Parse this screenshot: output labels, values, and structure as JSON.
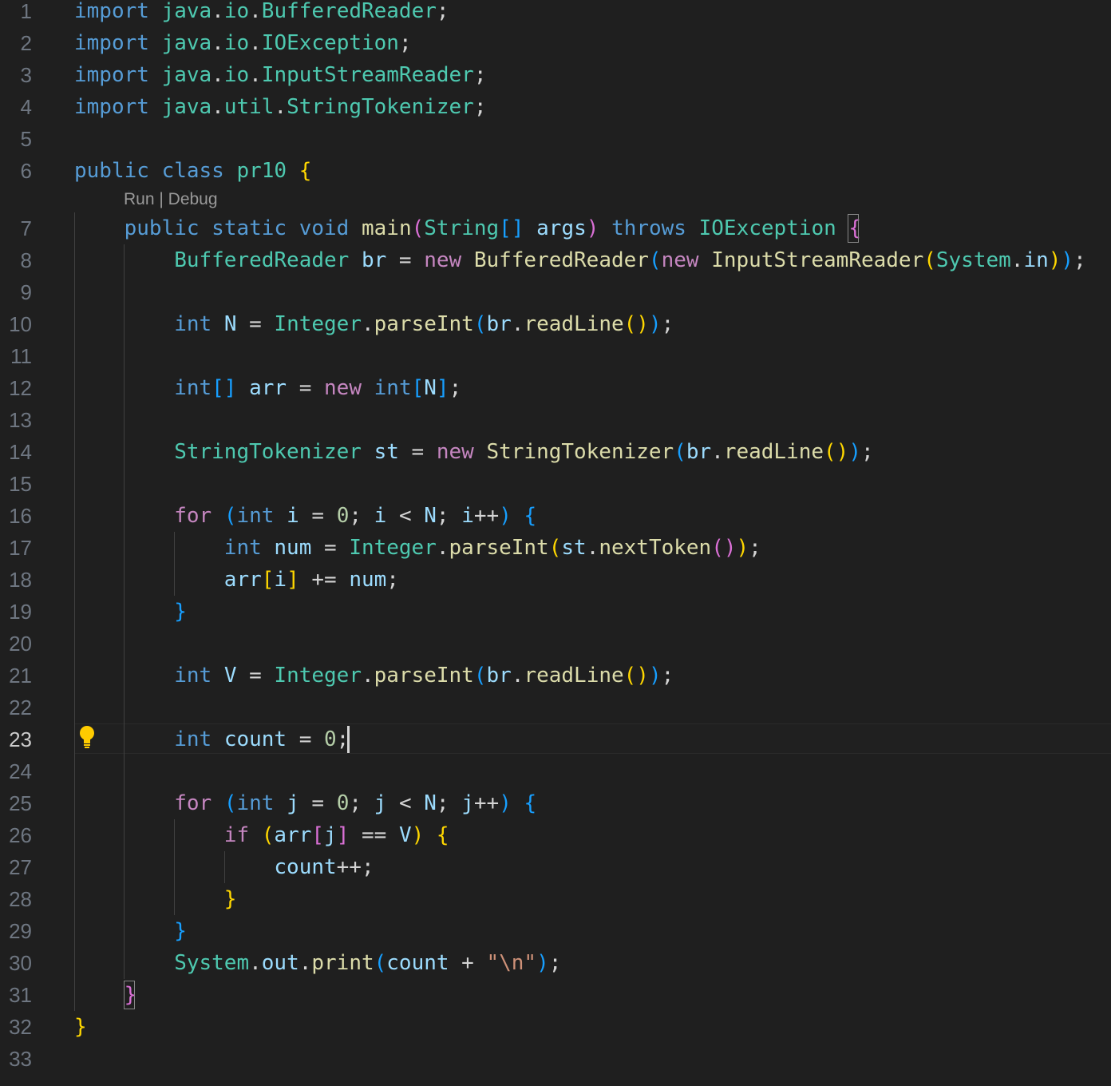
{
  "editor": {
    "active_line": 23,
    "codelens": {
      "run": "Run",
      "separator": " | ",
      "debug": "Debug"
    },
    "lines": [
      {
        "n": "1",
        "t": [
          [
            "import",
            "kw"
          ],
          [
            " ",
            ""
          ],
          [
            "java",
            "ty"
          ],
          [
            ".",
            ""
          ],
          [
            "io",
            "ty"
          ],
          [
            ".",
            ""
          ],
          [
            "BufferedReader",
            "ty"
          ],
          [
            ";",
            ""
          ]
        ]
      },
      {
        "n": "2",
        "t": [
          [
            "import",
            "kw"
          ],
          [
            " ",
            ""
          ],
          [
            "java",
            "ty"
          ],
          [
            ".",
            ""
          ],
          [
            "io",
            "ty"
          ],
          [
            ".",
            ""
          ],
          [
            "IOException",
            "ty"
          ],
          [
            ";",
            ""
          ]
        ]
      },
      {
        "n": "3",
        "t": [
          [
            "import",
            "kw"
          ],
          [
            " ",
            ""
          ],
          [
            "java",
            "ty"
          ],
          [
            ".",
            ""
          ],
          [
            "io",
            "ty"
          ],
          [
            ".",
            ""
          ],
          [
            "InputStreamReader",
            "ty"
          ],
          [
            ";",
            ""
          ]
        ]
      },
      {
        "n": "4",
        "t": [
          [
            "import",
            "kw"
          ],
          [
            " ",
            ""
          ],
          [
            "java",
            "ty"
          ],
          [
            ".",
            ""
          ],
          [
            "util",
            "ty"
          ],
          [
            ".",
            ""
          ],
          [
            "StringTokenizer",
            "ty"
          ],
          [
            ";",
            ""
          ]
        ]
      },
      {
        "n": "5",
        "t": []
      },
      {
        "n": "6",
        "t": [
          [
            "public",
            "kw"
          ],
          [
            " ",
            ""
          ],
          [
            "class",
            "kw"
          ],
          [
            " ",
            ""
          ],
          [
            "pr10",
            "ty"
          ],
          [
            " ",
            ""
          ],
          [
            "{",
            "b1"
          ]
        ]
      },
      {
        "n": "7",
        "t": [
          [
            "    ",
            ""
          ],
          [
            "public",
            "kw"
          ],
          [
            " ",
            ""
          ],
          [
            "static",
            "kw"
          ],
          [
            " ",
            ""
          ],
          [
            "void",
            "kw"
          ],
          [
            " ",
            ""
          ],
          [
            "main",
            "fn"
          ],
          [
            "(",
            "b2"
          ],
          [
            "String",
            "ty"
          ],
          [
            "[]",
            "b3"
          ],
          [
            " ",
            ""
          ],
          [
            "args",
            "var"
          ],
          [
            ")",
            "b2"
          ],
          [
            " ",
            ""
          ],
          [
            "throws",
            "kw"
          ],
          [
            " ",
            ""
          ],
          [
            "IOException",
            "ty"
          ],
          [
            " ",
            ""
          ],
          [
            "{",
            "b2"
          ]
        ]
      },
      {
        "n": "8",
        "t": [
          [
            "        ",
            ""
          ],
          [
            "BufferedReader",
            "ty"
          ],
          [
            " ",
            ""
          ],
          [
            "br",
            "var"
          ],
          [
            " = ",
            ""
          ],
          [
            "new",
            "ctl"
          ],
          [
            " ",
            ""
          ],
          [
            "BufferedReader",
            "fn"
          ],
          [
            "(",
            "b3"
          ],
          [
            "new",
            "ctl"
          ],
          [
            " ",
            ""
          ],
          [
            "InputStreamReader",
            "fn"
          ],
          [
            "(",
            "b1"
          ],
          [
            "System",
            "ty"
          ],
          [
            ".",
            ""
          ],
          [
            "in",
            "var"
          ],
          [
            ")",
            "b1"
          ],
          [
            ")",
            "b3"
          ],
          [
            ";",
            ""
          ]
        ]
      },
      {
        "n": "9",
        "t": []
      },
      {
        "n": "10",
        "t": [
          [
            "        ",
            ""
          ],
          [
            "int",
            "kw"
          ],
          [
            " ",
            ""
          ],
          [
            "N",
            "var"
          ],
          [
            " = ",
            ""
          ],
          [
            "Integer",
            "ty"
          ],
          [
            ".",
            ""
          ],
          [
            "parseInt",
            "fn"
          ],
          [
            "(",
            "b3"
          ],
          [
            "br",
            "var"
          ],
          [
            ".",
            ""
          ],
          [
            "readLine",
            "fn"
          ],
          [
            "()",
            "b1"
          ],
          [
            ")",
            "b3"
          ],
          [
            ";",
            ""
          ]
        ]
      },
      {
        "n": "11",
        "t": []
      },
      {
        "n": "12",
        "t": [
          [
            "        ",
            ""
          ],
          [
            "int",
            "kw"
          ],
          [
            "[]",
            "b3"
          ],
          [
            " ",
            ""
          ],
          [
            "arr",
            "var"
          ],
          [
            " = ",
            ""
          ],
          [
            "new",
            "ctl"
          ],
          [
            " ",
            ""
          ],
          [
            "int",
            "kw"
          ],
          [
            "[",
            "b3"
          ],
          [
            "N",
            "var"
          ],
          [
            "]",
            "b3"
          ],
          [
            ";",
            ""
          ]
        ]
      },
      {
        "n": "13",
        "t": []
      },
      {
        "n": "14",
        "t": [
          [
            "        ",
            ""
          ],
          [
            "StringTokenizer",
            "ty"
          ],
          [
            " ",
            ""
          ],
          [
            "st",
            "var"
          ],
          [
            " = ",
            ""
          ],
          [
            "new",
            "ctl"
          ],
          [
            " ",
            ""
          ],
          [
            "StringTokenizer",
            "fn"
          ],
          [
            "(",
            "b3"
          ],
          [
            "br",
            "var"
          ],
          [
            ".",
            ""
          ],
          [
            "readLine",
            "fn"
          ],
          [
            "()",
            "b1"
          ],
          [
            ")",
            "b3"
          ],
          [
            ";",
            ""
          ]
        ]
      },
      {
        "n": "15",
        "t": []
      },
      {
        "n": "16",
        "t": [
          [
            "        ",
            ""
          ],
          [
            "for",
            "ctl"
          ],
          [
            " ",
            ""
          ],
          [
            "(",
            "b3"
          ],
          [
            "int",
            "kw"
          ],
          [
            " ",
            ""
          ],
          [
            "i",
            "var"
          ],
          [
            " = ",
            ""
          ],
          [
            "0",
            "num"
          ],
          [
            "; ",
            ""
          ],
          [
            "i",
            "var"
          ],
          [
            " < ",
            ""
          ],
          [
            "N",
            "var"
          ],
          [
            "; ",
            ""
          ],
          [
            "i",
            "var"
          ],
          [
            "++",
            ""
          ],
          [
            ")",
            "b3"
          ],
          [
            " ",
            ""
          ],
          [
            "{",
            "b3"
          ]
        ]
      },
      {
        "n": "17",
        "t": [
          [
            "            ",
            ""
          ],
          [
            "int",
            "kw"
          ],
          [
            " ",
            ""
          ],
          [
            "num",
            "var"
          ],
          [
            " = ",
            ""
          ],
          [
            "Integer",
            "ty"
          ],
          [
            ".",
            ""
          ],
          [
            "parseInt",
            "fn"
          ],
          [
            "(",
            "b1"
          ],
          [
            "st",
            "var"
          ],
          [
            ".",
            ""
          ],
          [
            "nextToken",
            "fn"
          ],
          [
            "()",
            "b2"
          ],
          [
            ")",
            "b1"
          ],
          [
            ";",
            ""
          ]
        ]
      },
      {
        "n": "18",
        "t": [
          [
            "            ",
            ""
          ],
          [
            "arr",
            "var"
          ],
          [
            "[",
            "b1"
          ],
          [
            "i",
            "var"
          ],
          [
            "]",
            "b1"
          ],
          [
            " += ",
            ""
          ],
          [
            "num",
            "var"
          ],
          [
            ";",
            ""
          ]
        ]
      },
      {
        "n": "19",
        "t": [
          [
            "        ",
            ""
          ],
          [
            "}",
            "b3"
          ]
        ]
      },
      {
        "n": "20",
        "t": []
      },
      {
        "n": "21",
        "t": [
          [
            "        ",
            ""
          ],
          [
            "int",
            "kw"
          ],
          [
            " ",
            ""
          ],
          [
            "V",
            "var"
          ],
          [
            " = ",
            ""
          ],
          [
            "Integer",
            "ty"
          ],
          [
            ".",
            ""
          ],
          [
            "parseInt",
            "fn"
          ],
          [
            "(",
            "b3"
          ],
          [
            "br",
            "var"
          ],
          [
            ".",
            ""
          ],
          [
            "readLine",
            "fn"
          ],
          [
            "()",
            "b1"
          ],
          [
            ")",
            "b3"
          ],
          [
            ";",
            ""
          ]
        ]
      },
      {
        "n": "22",
        "t": []
      },
      {
        "n": "23",
        "t": [
          [
            "        ",
            ""
          ],
          [
            "int",
            "kw"
          ],
          [
            " ",
            ""
          ],
          [
            "count",
            "var"
          ],
          [
            " = ",
            ""
          ],
          [
            "0",
            "num"
          ],
          [
            ";",
            ""
          ]
        ]
      },
      {
        "n": "24",
        "t": []
      },
      {
        "n": "25",
        "t": [
          [
            "        ",
            ""
          ],
          [
            "for",
            "ctl"
          ],
          [
            " ",
            ""
          ],
          [
            "(",
            "b3"
          ],
          [
            "int",
            "kw"
          ],
          [
            " ",
            ""
          ],
          [
            "j",
            "var"
          ],
          [
            " = ",
            ""
          ],
          [
            "0",
            "num"
          ],
          [
            "; ",
            ""
          ],
          [
            "j",
            "var"
          ],
          [
            " < ",
            ""
          ],
          [
            "N",
            "var"
          ],
          [
            "; ",
            ""
          ],
          [
            "j",
            "var"
          ],
          [
            "++",
            ""
          ],
          [
            ")",
            "b3"
          ],
          [
            " ",
            ""
          ],
          [
            "{",
            "b3"
          ]
        ]
      },
      {
        "n": "26",
        "t": [
          [
            "            ",
            ""
          ],
          [
            "if",
            "ctl"
          ],
          [
            " ",
            ""
          ],
          [
            "(",
            "b1"
          ],
          [
            "arr",
            "var"
          ],
          [
            "[",
            "b2"
          ],
          [
            "j",
            "var"
          ],
          [
            "]",
            "b2"
          ],
          [
            " == ",
            ""
          ],
          [
            "V",
            "var"
          ],
          [
            ")",
            "b1"
          ],
          [
            " ",
            ""
          ],
          [
            "{",
            "b1"
          ]
        ]
      },
      {
        "n": "27",
        "t": [
          [
            "                ",
            ""
          ],
          [
            "count",
            "var"
          ],
          [
            "++;",
            ""
          ]
        ]
      },
      {
        "n": "28",
        "t": [
          [
            "            ",
            ""
          ],
          [
            "}",
            "b1"
          ]
        ]
      },
      {
        "n": "29",
        "t": [
          [
            "        ",
            ""
          ],
          [
            "}",
            "b3"
          ]
        ]
      },
      {
        "n": "30",
        "t": [
          [
            "        ",
            ""
          ],
          [
            "System",
            "ty"
          ],
          [
            ".",
            ""
          ],
          [
            "out",
            "var"
          ],
          [
            ".",
            ""
          ],
          [
            "print",
            "fn"
          ],
          [
            "(",
            "b3"
          ],
          [
            "count",
            "var"
          ],
          [
            " + ",
            ""
          ],
          [
            "\"\\n\"",
            "str"
          ],
          [
            ")",
            "b3"
          ],
          [
            ";",
            ""
          ]
        ]
      },
      {
        "n": "31",
        "t": [
          [
            "    ",
            ""
          ],
          [
            "}",
            "b2"
          ]
        ]
      },
      {
        "n": "32",
        "t": [
          [
            "}",
            "b1"
          ]
        ]
      },
      {
        "n": "33",
        "t": []
      }
    ]
  },
  "colors": {
    "background": "#1f1f1f",
    "line_number": "#6e7681",
    "line_number_active": "#cccccc",
    "keyword": "#569cd6",
    "control_keyword": "#c586c0",
    "type": "#4ec9b0",
    "function": "#dcdcaa",
    "variable": "#9cdcfe",
    "number": "#b5cea8",
    "string": "#ce9178",
    "bracket_1": "#ffd700",
    "bracket_2": "#da70d6",
    "bracket_3": "#179fff",
    "lightbulb": "#ffcc00"
  },
  "icons": {
    "lightbulb": "lightbulb-icon"
  }
}
